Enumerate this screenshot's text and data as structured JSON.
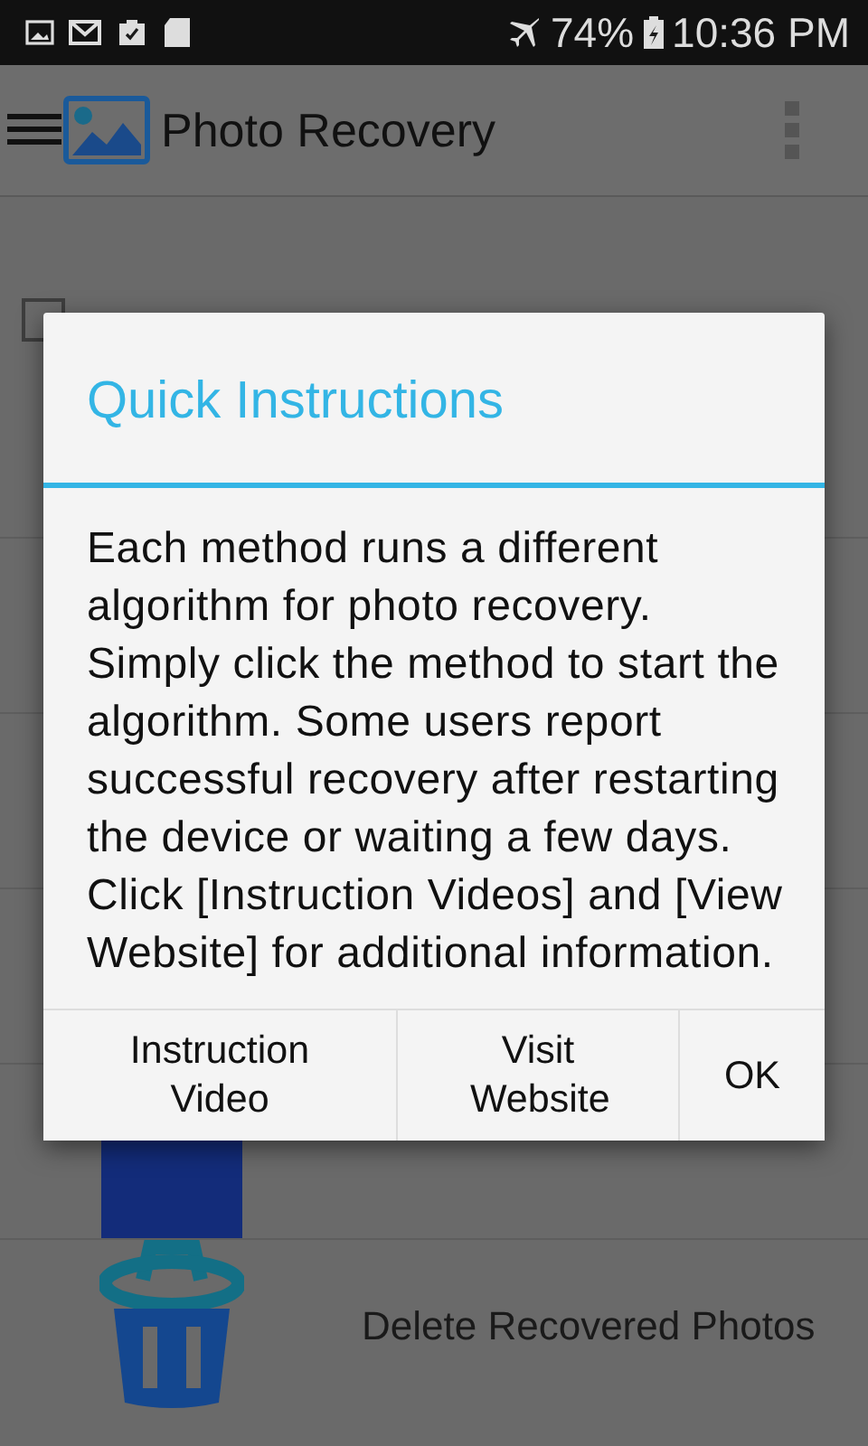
{
  "status_bar": {
    "battery": "74%",
    "time": "10:36 PM"
  },
  "app_bar": {
    "title": "Photo Recovery"
  },
  "option_row": {
    "checked": false
  },
  "list_items": [
    {
      "kind": "tile"
    },
    {
      "kind": "trash",
      "label": "Delete Recovered Photos"
    }
  ],
  "dialog": {
    "title": "Quick Instructions",
    "message": "Each method runs a different algorithm for photo recovery. Simply click the method to start the algorithm. Some users report successful recovery after restarting the device or waiting a few days. Click [Instruction Videos] and [View Website] for additional information.",
    "buttons": [
      "Instruction Video",
      "Visit Website",
      "OK"
    ]
  }
}
